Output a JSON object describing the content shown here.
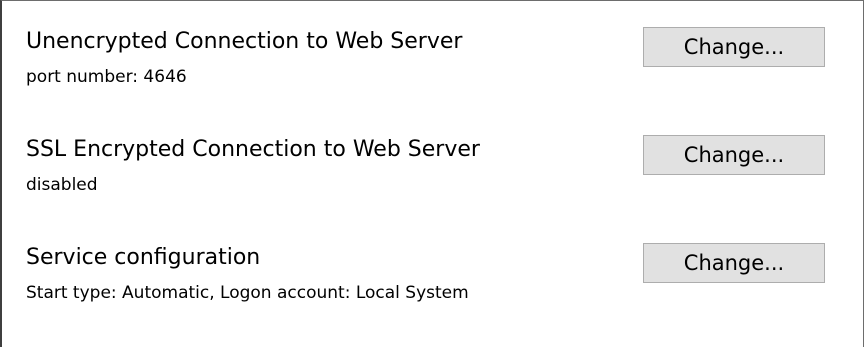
{
  "settings": [
    {
      "title": "Unencrypted Connection to Web Server",
      "value": "port number: 4646",
      "button_label": "Change..."
    },
    {
      "title": "SSL Encrypted Connection to Web Server",
      "value": "disabled",
      "button_label": "Change..."
    },
    {
      "title": "Service configuration",
      "value": "Start type: Automatic, Logon account: Local System",
      "button_label": "Change..."
    }
  ]
}
